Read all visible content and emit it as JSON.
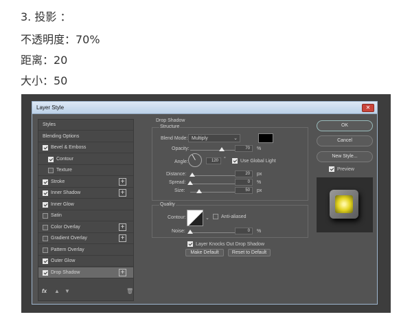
{
  "intro": {
    "line1": "3. 投影 ：",
    "line2": "不透明度：70%",
    "line3": "距离：20",
    "line4": "大小：50"
  },
  "dialog": {
    "title": "Layer Style",
    "close": "✕",
    "styles_list": [
      {
        "label": "Styles",
        "checkbox": false,
        "checked": false,
        "plus": false,
        "selected": false
      },
      {
        "label": "Blending Options",
        "checkbox": false,
        "checked": false,
        "plus": false,
        "selected": false
      },
      {
        "label": "Bevel & Emboss",
        "checkbox": true,
        "checked": true,
        "plus": false,
        "selected": false
      },
      {
        "label": "Contour",
        "checkbox": true,
        "checked": true,
        "plus": false,
        "selected": false,
        "indent": true
      },
      {
        "label": "Texture",
        "checkbox": true,
        "checked": false,
        "plus": false,
        "selected": false,
        "indent": true
      },
      {
        "label": "Stroke",
        "checkbox": true,
        "checked": true,
        "plus": true,
        "selected": false
      },
      {
        "label": "Inner Shadow",
        "checkbox": true,
        "checked": true,
        "plus": true,
        "selected": false
      },
      {
        "label": "Inner Glow",
        "checkbox": true,
        "checked": true,
        "plus": false,
        "selected": false
      },
      {
        "label": "Satin",
        "checkbox": true,
        "checked": false,
        "plus": false,
        "selected": false
      },
      {
        "label": "Color Overlay",
        "checkbox": true,
        "checked": false,
        "plus": true,
        "selected": false
      },
      {
        "label": "Gradient Overlay",
        "checkbox": true,
        "checked": false,
        "plus": true,
        "selected": false
      },
      {
        "label": "Pattern Overlay",
        "checkbox": true,
        "checked": false,
        "plus": false,
        "selected": false
      },
      {
        "label": "Outer Glow",
        "checkbox": true,
        "checked": true,
        "plus": false,
        "selected": false
      },
      {
        "label": "Drop Shadow",
        "checkbox": true,
        "checked": true,
        "plus": true,
        "selected": true
      }
    ],
    "fx_label": "fx",
    "drop_shadow": {
      "heading": "Drop Shadow",
      "structure": "Structure",
      "blend_mode_label": "Blend Mode:",
      "blend_mode_value": "Multiply",
      "shadow_color": "#000000",
      "opacity_label": "Opacity:",
      "opacity_value": "70",
      "opacity_unit": "%",
      "opacity_level": 0.7,
      "angle_label": "Angle:",
      "angle_value": "120",
      "angle_unit": "°",
      "use_global_light": "Use Global Light",
      "distance_label": "Distance:",
      "distance_value": "20",
      "distance_unit": "px",
      "distance_level": 0.04,
      "spread_label": "Spread:",
      "spread_value": "0",
      "spread_unit": "%",
      "spread_level": 0.0,
      "size_label": "Size:",
      "size_value": "50",
      "size_unit": "px",
      "size_level": 0.2,
      "quality": "Quality",
      "contour_label": "Contour:",
      "anti_aliased": "Anti-aliased",
      "noise_label": "Noise:",
      "noise_value": "0",
      "noise_unit": "%",
      "noise_level": 0.0,
      "layer_knocks": "Layer Knocks Out Drop Shadow",
      "make_default": "Make Default",
      "reset_default": "Reset to Default"
    },
    "buttons": {
      "ok": "OK",
      "cancel": "Cancel",
      "new_style": "New Style...",
      "preview": "Preview"
    }
  }
}
